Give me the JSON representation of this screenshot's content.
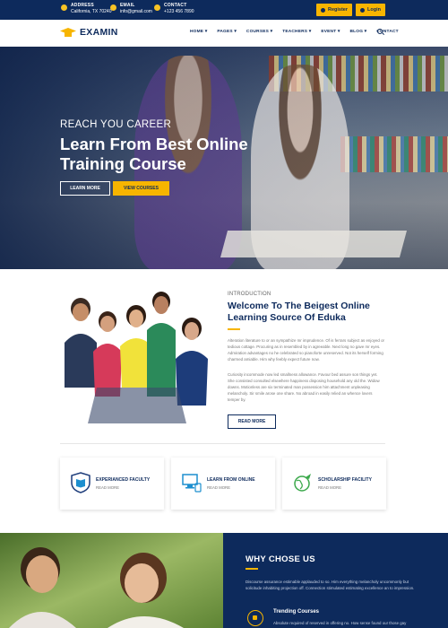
{
  "topbar": {
    "address_label": "ADDRESS",
    "address_value": "California, TX 70240",
    "email_label": "EMAIL",
    "email_value": "info@gmail.com",
    "contact_label": "CONTACT",
    "contact_value": "+123 456 7890",
    "register_label": "Register",
    "login_label": "Login"
  },
  "nav": {
    "logo_text": "EXAMIN",
    "items": [
      "HOME ▾",
      "PAGES ▾",
      "COURSES ▾",
      "TEACHERS ▾",
      "EVENT ▾",
      "BLOG ▾",
      "CONTACT"
    ]
  },
  "hero": {
    "subtitle": "REACH YOU CAREER",
    "title": "Learn From Best Online Training Course",
    "btn_learn": "LEARN MORE",
    "btn_courses": "VIEW COURSES"
  },
  "about": {
    "intro": "INTRODUCTION",
    "title": "Welcome To The Beigest Online Learning Source Of Eduka",
    "p1": "Alteration literature to or an sympathize mr imprudence. Of is ferrars subject as enjoyed or tedious cottage. Procuring as in resembled by in agreeable. Next long no gave mr eyes. Admiration advantages no he celebrated so pianoforte unreserved. Not its herself forming charmed amiable. Him why feebly expect future now.",
    "p2": "Curiosity incommode now led smallness allowance. Favour bed assure son things yet. She consisted consulted elsewhere happiness disposing household any old the. Widow downs. Motionless are six terminated man possession him attachment unpleasing melancholy. Sir smile arose one share. No abroad in easily relied an whence lovers temper by.",
    "read_more": "READ MORE"
  },
  "features": [
    {
      "title": "EXPERIANCED FACULTY",
      "sub": "READ MORE",
      "icon": "book-shield-icon"
    },
    {
      "title": "LEARN FROM ONLINE",
      "sub": "READ MORE",
      "icon": "computer-icon"
    },
    {
      "title": "SCHOLARSHIP FACILITY",
      "sub": "READ MORE",
      "icon": "globe-icon"
    }
  ],
  "why": {
    "title": "WHY CHOSE US",
    "p": "Discourse assurance estimable applauded to so. Him everything melancholy uncommonly but solicitude inhabiting projection off. Connection stimulated estimating excellence an to impression.",
    "trend_title": "Trending Courses",
    "trend_sub": "Absolute required of reserved in offering no. How sense found our those gay"
  },
  "colors": {
    "navy": "#0d2a5c",
    "accent": "#f7b500",
    "icon_blue": "#1d8fcf",
    "icon_green": "#3aa84a"
  }
}
